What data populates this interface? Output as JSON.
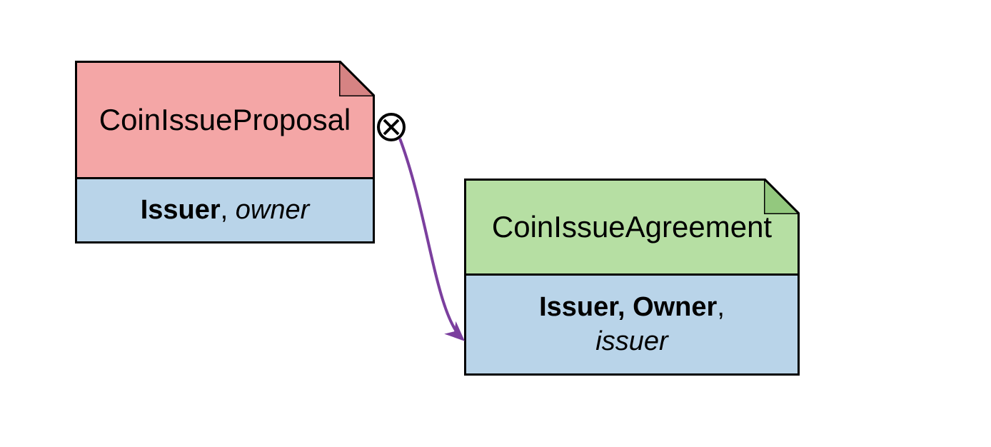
{
  "diagram": {
    "nodes": {
      "left": {
        "title": "CoinIssueProposal",
        "party_bold": "Issuer",
        "party_sep": ", ",
        "party_ital": "owner",
        "title_bg": "#f4a6a6",
        "dogear_fill": "#d68383",
        "parties_bg": "#b9d4e9"
      },
      "right": {
        "title": "CoinIssueAgreement",
        "party_bold": "Issuer, Owner",
        "party_sep": ", ",
        "party_ital": "issuer",
        "title_bg": "#b6dfa3",
        "dogear_fill": "#93c87e",
        "parties_bg": "#b9d4e9"
      }
    },
    "arrow_color": "#7b3f9e"
  }
}
